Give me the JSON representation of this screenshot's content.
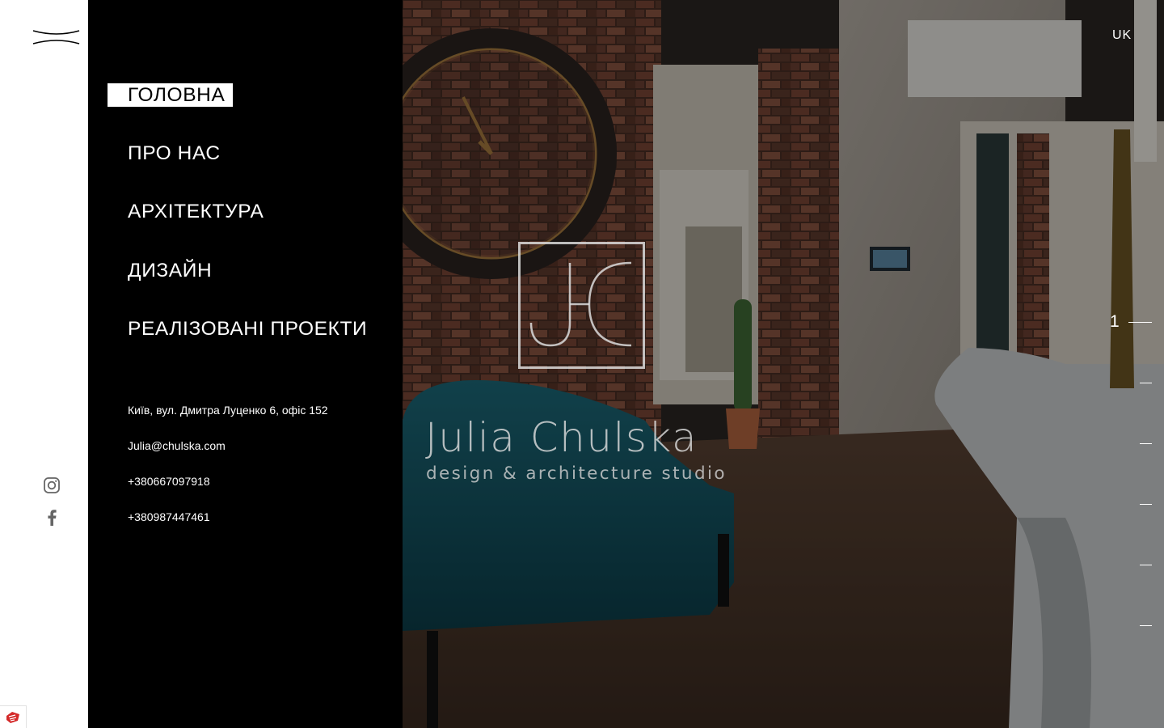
{
  "nav": {
    "items": [
      {
        "label": "ГОЛОВНА",
        "active": true
      },
      {
        "label": "ПРО НАС",
        "active": false
      },
      {
        "label": "АРХІТЕКТУРА",
        "active": false
      },
      {
        "label": "ДИЗАЙН",
        "active": false
      },
      {
        "label": "РЕАЛІЗОВАНІ ПРОЕКТИ",
        "active": false
      }
    ]
  },
  "contacts": {
    "address": "Київ, вул. Дмитра Луценко 6, офіс 152",
    "email": "Julia@chulska.com",
    "phone1": "+380667097918",
    "phone2": "+380987447461"
  },
  "social": {
    "icons": [
      "instagram-icon",
      "facebook-icon"
    ]
  },
  "hero": {
    "brand_name": "Julia Chulska",
    "tagline": "design & architecture studio",
    "language": "UK"
  },
  "slider": {
    "current": "1",
    "total_indicators": 6
  },
  "colors": {
    "panel": "#000000",
    "rail": "#ffffff",
    "text_light": "#ffffff",
    "accent_sofa": "#0f4a58"
  }
}
